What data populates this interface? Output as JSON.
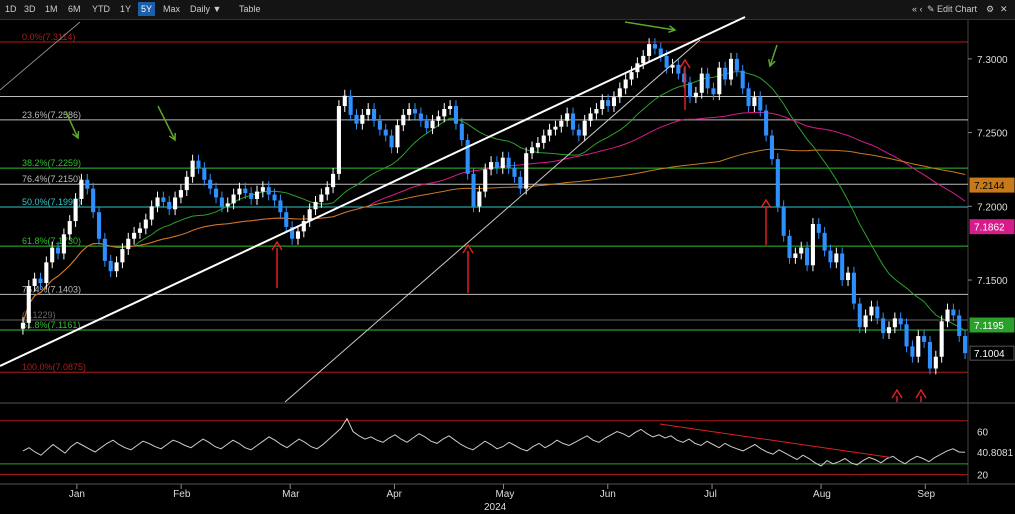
{
  "toolbar": {
    "ranges": [
      "1D",
      "3D",
      "1M",
      "6M",
      "YTD",
      "1Y",
      "5Y",
      "Max"
    ],
    "active_range": "5Y",
    "interval": "Daily ▼",
    "table": "Table",
    "nav": "« ‹",
    "edit": "✎ Edit Chart",
    "settings_icon": "gear-icon",
    "close_icon": "close-icon"
  },
  "colors": {
    "up": "#ffffff",
    "down": "#2e8fff",
    "ma_fast": "#2aa12a",
    "ma_mid": "#d81b8a",
    "ma_slow": "#c87a1a",
    "fib_red": "#b01c1c",
    "fib_green": "#2fbf2f",
    "fib_cyan": "#35c6c6",
    "fib_white": "#bbbbbb",
    "rsi": "#cccccc",
    "annotation_arrow": "#e02020",
    "annotation_green": "#5ca82a"
  },
  "chart_data": {
    "type": "candlestick",
    "ylim": [
      7.07,
      7.325
    ],
    "x_year": "2024",
    "months": [
      {
        "label": "Jan",
        "t": 0.06
      },
      {
        "label": "Feb",
        "t": 0.17
      },
      {
        "label": "Mar",
        "t": 0.285
      },
      {
        "label": "Apr",
        "t": 0.395
      },
      {
        "label": "May",
        "t": 0.51
      },
      {
        "label": "Jun",
        "t": 0.62
      },
      {
        "label": "Jul",
        "t": 0.73
      },
      {
        "label": "Aug",
        "t": 0.845
      },
      {
        "label": "Sep",
        "t": 0.955
      }
    ],
    "y_ticks": [
      "7.3000",
      "7.2500",
      "7.2000",
      "7.1500"
    ],
    "y_tick_values": [
      7.3,
      7.25,
      7.2,
      7.15
    ],
    "fib_levels": [
      {
        "label": "0.0%(7.3114)",
        "value": 7.3114,
        "color": "#b01c1c"
      },
      {
        "label": "23.6%(7.2586)",
        "value": 7.2586,
        "color": "#bbbbbb"
      },
      {
        "label": "38.2%(7.2259)",
        "value": 7.2259,
        "color": "#2fbf2f"
      },
      {
        "label": "76.4%(7.2150)",
        "value": 7.215,
        "color": "#bbbbbb"
      },
      {
        "label": "50.0%(7.1995)",
        "value": 7.1995,
        "color": "#35c6c6"
      },
      {
        "label": "61.8%(7.1730)",
        "value": 7.173,
        "color": "#2fbf2f"
      },
      {
        "label": "76.4%(7.1403)",
        "value": 7.1403,
        "color": "#bbbbbb"
      },
      {
        "label": "(7.1229)",
        "value": 7.1229,
        "color": "#666666"
      },
      {
        "label": "61.8%(7.1161)",
        "value": 7.1161,
        "color": "#2fbf2f"
      },
      {
        "label": "100.0%(7.0875)",
        "value": 7.0875,
        "color": "#b01c1c"
      }
    ],
    "horizontal_lines_extra": [
      7.2745
    ],
    "price_labels": [
      {
        "value": 7.2144,
        "text": "7.2144",
        "bg": "#c87a1a",
        "fg": "#000000"
      },
      {
        "value": 7.1862,
        "text": "7.1862",
        "bg": "#d81b8a",
        "fg": "#ffffff"
      },
      {
        "value": 7.1195,
        "text": "7.1195",
        "bg": "#2aa12a",
        "fg": "#ffffff"
      },
      {
        "value": 7.1004,
        "text": "7.1004",
        "bg": "#000000",
        "fg": "#ffffff"
      }
    ],
    "closes": [
      7.121,
      7.146,
      7.151,
      7.148,
      7.162,
      7.172,
      7.168,
      7.181,
      7.19,
      7.205,
      7.218,
      7.212,
      7.196,
      7.178,
      7.163,
      7.156,
      7.162,
      7.171,
      7.178,
      7.182,
      7.185,
      7.191,
      7.2,
      7.206,
      7.203,
      7.198,
      7.206,
      7.211,
      7.22,
      7.231,
      7.226,
      7.218,
      7.212,
      7.206,
      7.2,
      7.202,
      7.208,
      7.212,
      7.209,
      7.205,
      7.21,
      7.213,
      7.208,
      7.204,
      7.196,
      7.186,
      7.178,
      7.183,
      7.19,
      7.198,
      7.203,
      7.208,
      7.213,
      7.222,
      7.268,
      7.275,
      7.262,
      7.256,
      7.262,
      7.266,
      7.258,
      7.252,
      7.248,
      7.24,
      7.255,
      7.262,
      7.266,
      7.263,
      7.258,
      7.253,
      7.258,
      7.261,
      7.266,
      7.268,
      7.256,
      7.245,
      7.222,
      7.2,
      7.21,
      7.225,
      7.23,
      7.226,
      7.233,
      7.226,
      7.22,
      7.212,
      7.236,
      7.24,
      7.243,
      7.248,
      7.252,
      7.254,
      7.258,
      7.263,
      7.252,
      7.248,
      7.258,
      7.263,
      7.266,
      7.272,
      7.268,
      7.274,
      7.28,
      7.286,
      7.291,
      7.297,
      7.302,
      7.31,
      7.307,
      7.302,
      7.294,
      7.296,
      7.29,
      7.284,
      7.274,
      7.277,
      7.29,
      7.28,
      7.276,
      7.294,
      7.286,
      7.3,
      7.292,
      7.28,
      7.268,
      7.274,
      7.265,
      7.248,
      7.232,
      7.2,
      7.18,
      7.165,
      7.168,
      7.172,
      7.16,
      7.188,
      7.182,
      7.17,
      7.162,
      7.168,
      7.15,
      7.155,
      7.134,
      7.118,
      7.126,
      7.132,
      7.124,
      7.114,
      7.118,
      7.124,
      7.12,
      7.105,
      7.098,
      7.112,
      7.108,
      7.09,
      7.098,
      7.122,
      7.13,
      7.126,
      7.112,
      7.1004
    ],
    "rsi": {
      "ylim": [
        15,
        80
      ],
      "ticks": [
        60,
        40.8081,
        20
      ],
      "last": "40.8081",
      "values": [
        42,
        45,
        41,
        38,
        43,
        48,
        44,
        40,
        46,
        50,
        47,
        44,
        41,
        45,
        49,
        52,
        48,
        45,
        43,
        47,
        51,
        49,
        46,
        44,
        48,
        52,
        50,
        47,
        45,
        49,
        53,
        50,
        46,
        44,
        48,
        52,
        49,
        45,
        43,
        47,
        51,
        55,
        52,
        48,
        45,
        49,
        53,
        50,
        46,
        44,
        48,
        53,
        58,
        63,
        72,
        60,
        56,
        53,
        55,
        52,
        50,
        54,
        57,
        53,
        50,
        54,
        58,
        55,
        51,
        49,
        53,
        56,
        52,
        48,
        45,
        43,
        47,
        51,
        48,
        44,
        46,
        50,
        47,
        44,
        42,
        46,
        49,
        45,
        48,
        52,
        49,
        47,
        50,
        53,
        56,
        52,
        50,
        54,
        57,
        60,
        58,
        55,
        59,
        62,
        58,
        55,
        57,
        54,
        56,
        52,
        50,
        53,
        49,
        47,
        51,
        48,
        45,
        49,
        46,
        44,
        42,
        45,
        48,
        44,
        41,
        39,
        43,
        40,
        37,
        34,
        38,
        35,
        31,
        28,
        33,
        30,
        32,
        35,
        31,
        29,
        33,
        36,
        34,
        31,
        35,
        37,
        33,
        30,
        34,
        37,
        35,
        32,
        36,
        39,
        42,
        44,
        41,
        40.8
      ]
    }
  },
  "annotations": {
    "arrows_up": 8,
    "arrows_down_green": 6
  }
}
